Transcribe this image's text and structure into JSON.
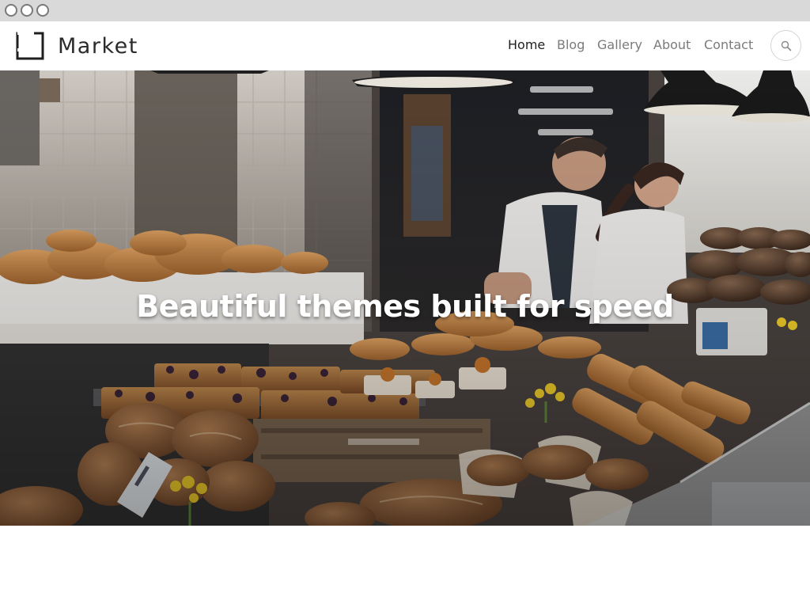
{
  "window": {
    "controls": [
      "close",
      "minimize",
      "maximize"
    ]
  },
  "header": {
    "logo_text": "Market",
    "logo_icon": "square-bracket-logo-icon",
    "nav": [
      {
        "label": "Home",
        "active": true
      },
      {
        "label": "Blog",
        "active": false
      },
      {
        "label": "Gallery",
        "active": false
      },
      {
        "label": "About",
        "active": false
      },
      {
        "label": "Contact",
        "active": false
      }
    ],
    "search_icon": "search-icon"
  },
  "hero": {
    "title": "Beautiful themes built for speed",
    "image_subject": "bakery counter with bread and pastries"
  },
  "colors": {
    "nav_active": "#1e1e1e",
    "nav_inactive": "#7b7b7b",
    "chrome_bar": "#d9d9d9",
    "hero_text": "#ffffff"
  }
}
